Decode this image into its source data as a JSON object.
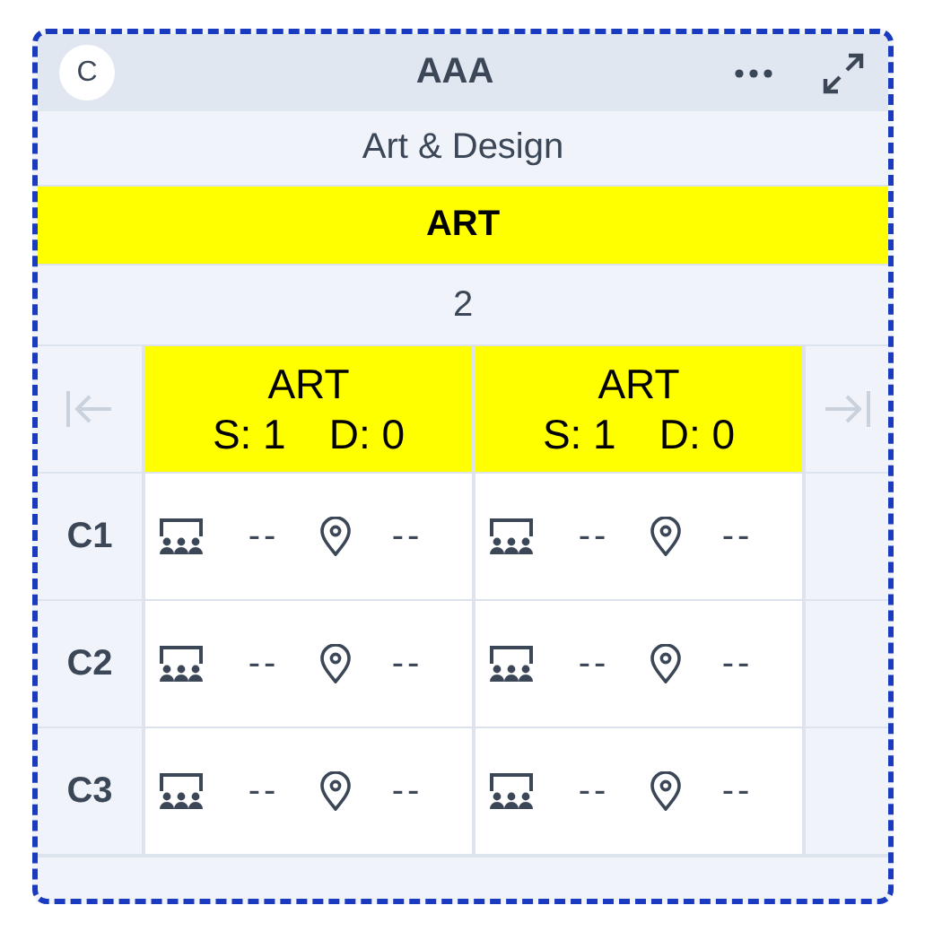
{
  "card": {
    "badge": "C",
    "title": "AAA",
    "subtitle": "Art & Design",
    "subject": {
      "label": "ART",
      "color": "#ffff00"
    },
    "count": "2"
  },
  "nav": {
    "prev_disabled": true,
    "next_disabled": true
  },
  "columns": [
    {
      "label": "ART",
      "stats": "S: 1",
      "detail": "D: 0",
      "color": "#ffff00"
    },
    {
      "label": "ART",
      "stats": "S: 1",
      "detail": "D: 0",
      "color": "#ffff00"
    }
  ],
  "rows": [
    {
      "label": "C1",
      "cells": [
        {
          "room": "--",
          "location": "--"
        },
        {
          "room": "--",
          "location": "--"
        }
      ]
    },
    {
      "label": "C2",
      "cells": [
        {
          "room": "--",
          "location": "--"
        },
        {
          "room": "--",
          "location": "--"
        }
      ]
    },
    {
      "label": "C3",
      "cells": [
        {
          "room": "--",
          "location": "--"
        },
        {
          "room": "--",
          "location": "--"
        }
      ]
    }
  ]
}
